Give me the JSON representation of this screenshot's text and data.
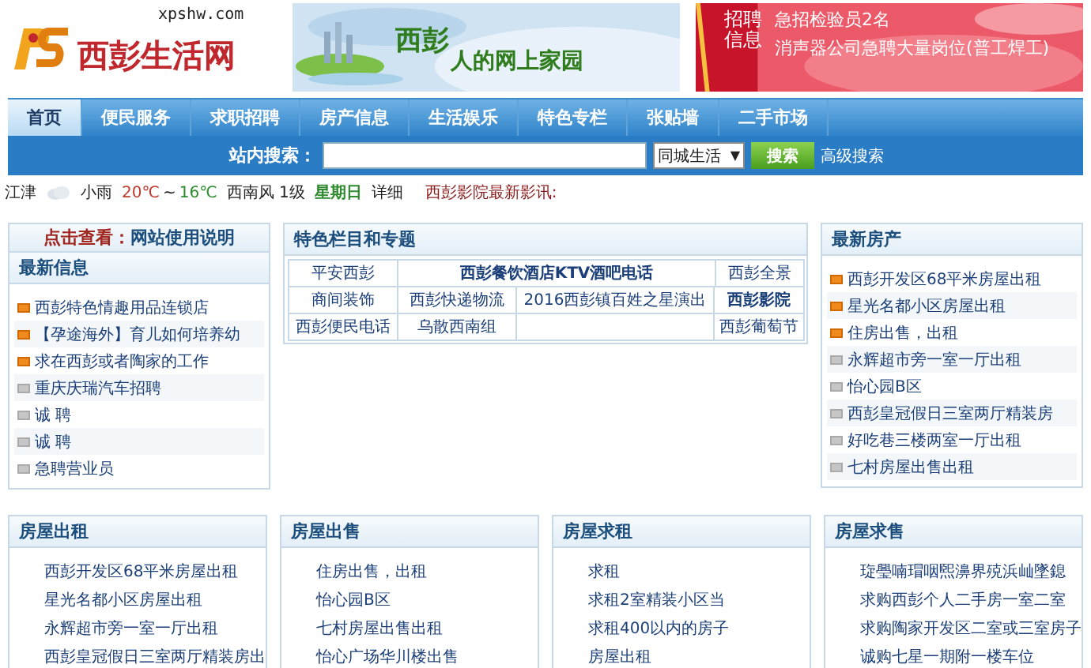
{
  "header": {
    "logo_text": "西彭生活网",
    "logo_url": "xpshw.com",
    "banner": {
      "slogan_1": "西彭",
      "slogan_2": "人的网上家园"
    },
    "ad": {
      "badge": "招聘信息",
      "lines": [
        "急招检验员2名",
        "消声器公司急聘大量岗位(普工焊工)"
      ]
    }
  },
  "nav": [
    {
      "label": "首页",
      "selected": true
    },
    {
      "label": "便民服务",
      "selected": false
    },
    {
      "label": "求职招聘",
      "selected": false
    },
    {
      "label": "房产信息",
      "selected": false
    },
    {
      "label": "生活娱乐",
      "selected": false
    },
    {
      "label": "特色专栏",
      "selected": false
    },
    {
      "label": "张贴墙",
      "selected": false
    },
    {
      "label": "二手市场",
      "selected": false
    }
  ],
  "search": {
    "label": "站内搜索：",
    "scope": "同城生活",
    "scope_arrow": "▼",
    "button": "搜索",
    "advanced": "高级搜索"
  },
  "weather": {
    "city": "江津",
    "condition": "小雨",
    "high": "20℃",
    "sep": "~",
    "low": "16℃",
    "wind": "西南风 1级",
    "weekday": "星期日",
    "detail": "详细",
    "cinema": "西彭影院最新影讯:"
  },
  "left": {
    "notice_prefix": "点击查看：",
    "notice_link": "网站使用说明",
    "title": "最新信息",
    "items": [
      {
        "text": "西彭特色情趣用品连锁店",
        "hot": true
      },
      {
        "text": "【孕途海外】育儿如何培养幼",
        "hot": true
      },
      {
        "text": "求在西彭或者陶家的工作",
        "hot": true
      },
      {
        "text": "重庆庆瑞汽车招聘",
        "hot": false
      },
      {
        "text": "诚 聘",
        "hot": false
      },
      {
        "text": "诚 聘",
        "hot": false
      },
      {
        "text": "急聘营业员",
        "hot": false
      }
    ]
  },
  "featured": {
    "title": "特色栏目和专题",
    "rows": [
      [
        {
          "text": "平安西彭",
          "kind": "plain"
        },
        {
          "text": "西彭餐饮酒店KTV酒吧电话",
          "kind": "wide-bold"
        },
        {
          "kind": "covered"
        },
        {
          "text": "西彭全景",
          "kind": "plain"
        }
      ],
      [
        {
          "text": "商间装饰",
          "kind": "plain"
        },
        {
          "text": "西彭快递物流",
          "kind": "plain"
        },
        {
          "text": "2016西彭镇百姓之星演出",
          "kind": "plain"
        },
        {
          "text": "西彭影院",
          "kind": "bold"
        }
      ],
      [
        {
          "text": "西彭便民电话",
          "kind": "plain"
        },
        {
          "text": "乌散西南组",
          "kind": "plain"
        },
        {
          "kind": "blank"
        },
        {
          "text": "西彭葡萄节",
          "kind": "plain"
        }
      ]
    ]
  },
  "right": {
    "title": "最新房产",
    "items": [
      {
        "text": "西彭开发区68平米房屋出租",
        "hot": true
      },
      {
        "text": "星光名都小区房屋出租",
        "hot": true
      },
      {
        "text": "住房出售，出租",
        "hot": true
      },
      {
        "text": "永辉超市旁一室一厅出租",
        "hot": false
      },
      {
        "text": "怡心园B区",
        "hot": false
      },
      {
        "text": "西彭皇冠假日三室两厅精装房",
        "hot": false
      },
      {
        "text": "好吃巷三楼两室一厅出租",
        "hot": false
      },
      {
        "text": "七村房屋出售出租",
        "hot": false
      }
    ]
  },
  "boxes": [
    {
      "title": "房屋出租",
      "items": [
        "西彭开发区68平米房屋出租",
        "星光名都小区房屋出租",
        "永辉超市旁一室一厅出租",
        "西彭皇冠假日三室两厅精装房出"
      ]
    },
    {
      "title": "房屋出售",
      "items": [
        "住房出售，出租",
        "怡心园B区",
        "七村房屋出售出租",
        "怡心广场华川楼出售"
      ]
    },
    {
      "title": "房屋求租",
      "items": [
        "求租",
        "求租2室精装小区当",
        "求租400以内的房子",
        "房屋出租"
      ]
    },
    {
      "title": "房屋求售",
      "items": [
        "琁璺喃瑁咽煕濞界殑浜屾墜鎴",
        "求购西彭个人二手房一室二室",
        "求购陶家开发区二室或三室房子",
        "诚购七星一期附一楼车位"
      ]
    }
  ]
}
